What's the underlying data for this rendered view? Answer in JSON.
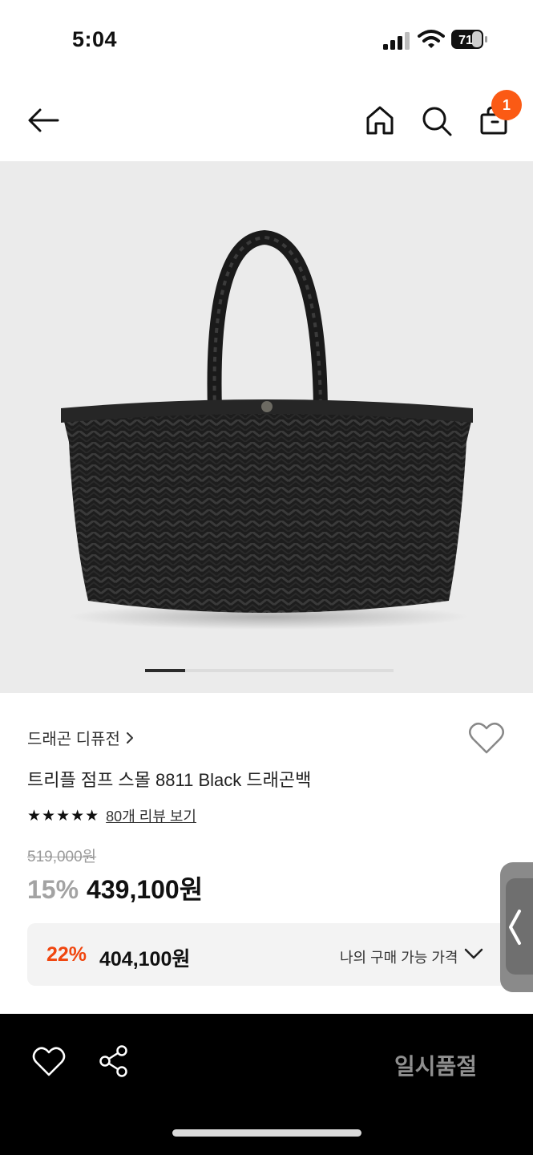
{
  "status_bar": {
    "time": "5:04",
    "battery": "71"
  },
  "product": {
    "brand": "드래곤 디퓨전",
    "title": "트리플 점프 스몰 8811 Black 드래곤백",
    "stars": "★★★★★",
    "review_link": "80개 리뷰 보기",
    "original_price": "519,000원",
    "discount_rate": "15%",
    "sale_price": "439,100원"
  },
  "my_price": {
    "discount_rate": "22%",
    "price": "404,100원",
    "label": "나의 구매 가능 가격"
  },
  "header": {
    "cart_count": "1"
  },
  "bottom_bar": {
    "soldout_label": "일시품절"
  },
  "colors": {
    "accent": "#fb5a14",
    "discount_red": "#f0460f"
  }
}
